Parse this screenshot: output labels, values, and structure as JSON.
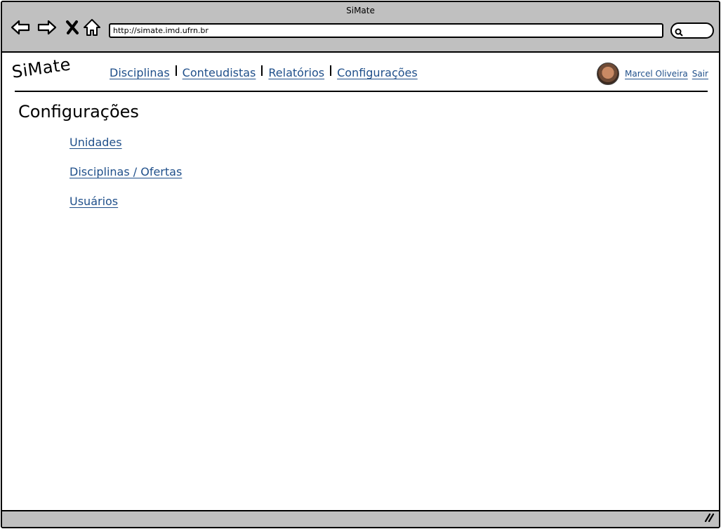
{
  "window": {
    "title": "SiMate"
  },
  "browser": {
    "url": "http://simate.imd.ufrn.br",
    "icons": {
      "back": "back-arrow-icon",
      "forward": "forward-arrow-icon",
      "stop": "close-x-icon",
      "home": "home-icon",
      "search": "search-icon"
    }
  },
  "app": {
    "logo": "SiMate",
    "nav": [
      {
        "label": "Disciplinas"
      },
      {
        "label": "Conteudistas"
      },
      {
        "label": "Relatórios"
      },
      {
        "label": "Configurações"
      }
    ],
    "user": {
      "name": "Marcel Oliveira",
      "logout_label": "Sair"
    }
  },
  "page": {
    "title": "Configurações",
    "links": [
      {
        "label": "Unidades"
      },
      {
        "label": "Disciplinas / Ofertas"
      },
      {
        "label": "Usuários"
      }
    ]
  },
  "colors": {
    "link": "#1f4f8a",
    "chrome": "#c0c0c0"
  }
}
